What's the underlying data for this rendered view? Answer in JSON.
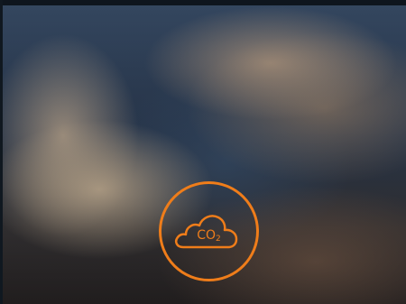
{
  "badge": {
    "formula": "CO",
    "subscript": "2",
    "color": "#ef7d1a"
  },
  "icons": {
    "badge_icon": "cloud-co2-icon"
  }
}
